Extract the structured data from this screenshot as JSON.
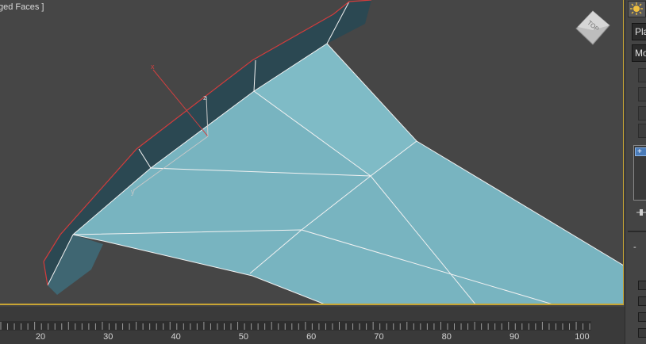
{
  "viewport": {
    "label": "ged Faces ]",
    "viewcube_label": "TOP"
  },
  "timeline": {
    "tick_labels": [
      "20",
      "30",
      "40",
      "50",
      "60",
      "70",
      "80",
      "90",
      "100"
    ]
  },
  "command_panel": {
    "dropdown_1": "Pla",
    "dropdown_2": "Mo",
    "list_item": "+",
    "rollout_toggle": "-"
  },
  "colors": {
    "viewport_bg": "#464646",
    "mesh_face": "#78b4c0",
    "mesh_dark": "#25404a",
    "edge_red": "#d23c3c",
    "active_border": "#c8a534"
  }
}
